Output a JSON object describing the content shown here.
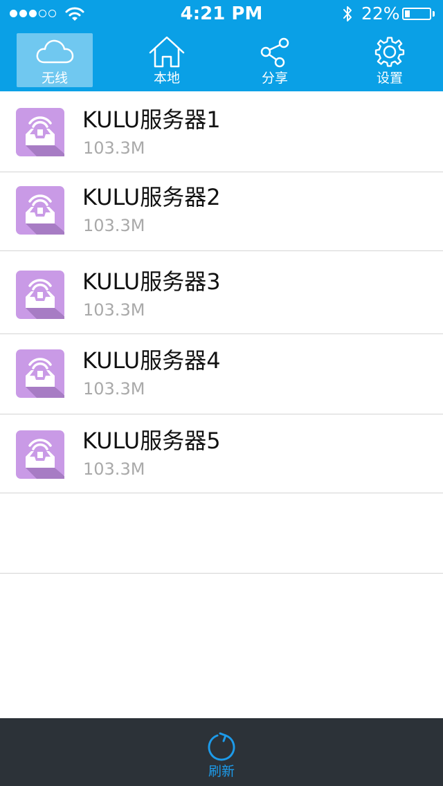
{
  "status_bar": {
    "time": "4:21 PM",
    "battery_percent": "22%",
    "battery_level": 0.22,
    "signal_bars_filled": 3,
    "signal_bars_total": 5
  },
  "tabs": [
    {
      "label": "无线",
      "icon": "cloud-icon",
      "active": true
    },
    {
      "label": "本地",
      "icon": "home-icon",
      "active": false
    },
    {
      "label": "分享",
      "icon": "share-icon",
      "active": false
    },
    {
      "label": "设置",
      "icon": "gear-icon",
      "active": false
    }
  ],
  "servers": [
    {
      "name": "KULU服务器1",
      "size": "103.3M",
      "icon": "wireless-server-icon"
    },
    {
      "name": "KULU服务器2",
      "size": "103.3M",
      "icon": "wireless-server-icon"
    },
    {
      "name": "KULU服务器3",
      "size": "103.3M",
      "icon": "wireless-server-icon"
    },
    {
      "name": "KULU服务器4",
      "size": "103.3M",
      "icon": "wireless-server-icon"
    },
    {
      "name": "KULU服务器5",
      "size": "103.3M",
      "icon": "wireless-server-icon"
    }
  ],
  "bottom_bar": {
    "refresh_label": "刷新",
    "refresh_icon": "refresh-icon"
  },
  "colors": {
    "header": "#0aa0e6",
    "bottom_bar": "#2c3238",
    "accent": "#1d9bea",
    "server_icon": "#c99ae6"
  }
}
